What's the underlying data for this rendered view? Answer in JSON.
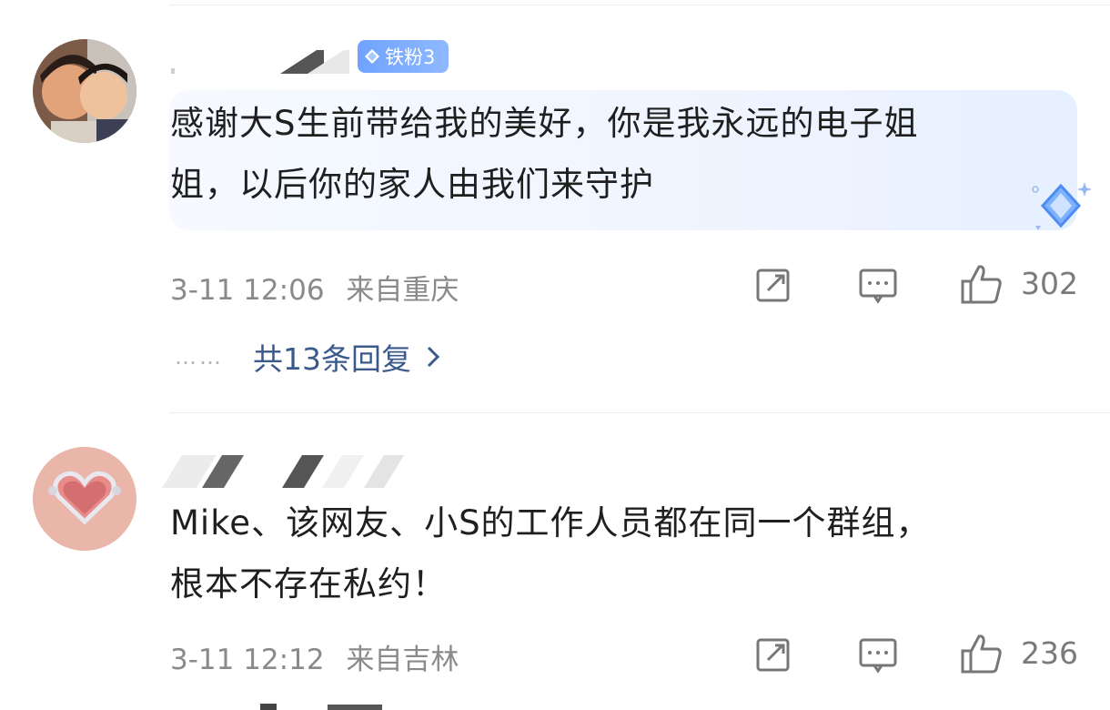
{
  "comments": [
    {
      "badge": "铁粉3",
      "text_line1": "感谢大S生前带给我的美好，你是我永远的电子姐",
      "text_line2": "姐，以后你的家人由我们来守护",
      "time": "3-11 12:06",
      "location": "来自重庆",
      "likes": "302",
      "replies_label": "共13条回复",
      "replies_dots": "……"
    },
    {
      "text_line1": "Mike、该网友、小S的工作人员都在同一个群组，",
      "text_line2": "根本不存在私约！",
      "time": "3-11 12:12",
      "location": "来自吉林",
      "likes": "236"
    }
  ],
  "icons": {
    "repost": "repost-icon",
    "comment": "comment-icon",
    "like": "thumbs-up-icon",
    "chevron": "chevron-right-icon",
    "badge": "diamond-icon"
  },
  "colors": {
    "badge_bg": "#7aa9ff",
    "reply_link": "#3a5a8c",
    "meta_text": "#8a8a8a"
  }
}
